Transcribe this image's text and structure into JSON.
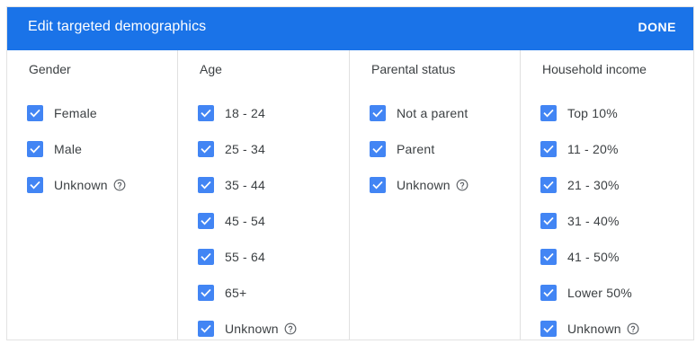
{
  "dialog": {
    "title": "Edit targeted demographics",
    "done_label": "DONE"
  },
  "columns": [
    {
      "title": "Gender",
      "options": [
        {
          "label": "Female",
          "checked": true,
          "help": false
        },
        {
          "label": "Male",
          "checked": true,
          "help": false
        },
        {
          "label": "Unknown",
          "checked": true,
          "help": true
        }
      ]
    },
    {
      "title": "Age",
      "options": [
        {
          "label": "18 - 24",
          "checked": true,
          "help": false
        },
        {
          "label": "25 - 34",
          "checked": true,
          "help": false
        },
        {
          "label": "35 - 44",
          "checked": true,
          "help": false
        },
        {
          "label": "45 - 54",
          "checked": true,
          "help": false
        },
        {
          "label": "55 - 64",
          "checked": true,
          "help": false
        },
        {
          "label": "65+",
          "checked": true,
          "help": false
        },
        {
          "label": "Unknown",
          "checked": true,
          "help": true
        }
      ]
    },
    {
      "title": "Parental status",
      "options": [
        {
          "label": "Not a parent",
          "checked": true,
          "help": false
        },
        {
          "label": "Parent",
          "checked": true,
          "help": false
        },
        {
          "label": "Unknown",
          "checked": true,
          "help": true
        }
      ]
    },
    {
      "title": "Household income",
      "options": [
        {
          "label": "Top 10%",
          "checked": true,
          "help": false
        },
        {
          "label": "11 - 20%",
          "checked": true,
          "help": false
        },
        {
          "label": "21 - 30%",
          "checked": true,
          "help": false
        },
        {
          "label": "31 - 40%",
          "checked": true,
          "help": false
        },
        {
          "label": "41 - 50%",
          "checked": true,
          "help": false
        },
        {
          "label": "Lower 50%",
          "checked": true,
          "help": false
        },
        {
          "label": "Unknown",
          "checked": true,
          "help": true
        }
      ]
    }
  ],
  "colors": {
    "header": "#1a73e8",
    "checkbox": "#4285f4",
    "text": "#3c4043"
  },
  "icons": {
    "checkbox": "check-icon",
    "help": "help-circle-icon"
  }
}
